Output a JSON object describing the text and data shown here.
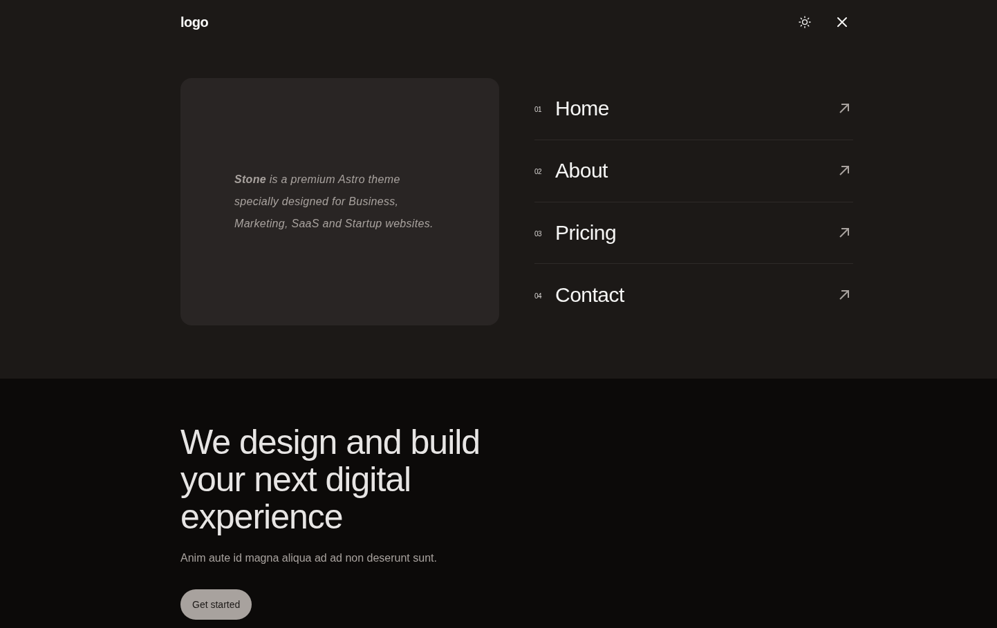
{
  "header": {
    "logo": "logo"
  },
  "menu": {
    "blurb": "**Stone** is a premium Astro theme specially designed for Business, Marketing, SaaS and Startup websites.",
    "items": [
      {
        "number": "01",
        "label": "Home"
      },
      {
        "number": "02",
        "label": "About"
      },
      {
        "number": "03",
        "label": "Pricing"
      },
      {
        "number": "04",
        "label": "Contact"
      }
    ]
  },
  "hero": {
    "heading": "We design and build your next digital experience",
    "text": "Anim aute id magna aliqua ad ad non deserunt sunt.",
    "button": "Get started"
  }
}
